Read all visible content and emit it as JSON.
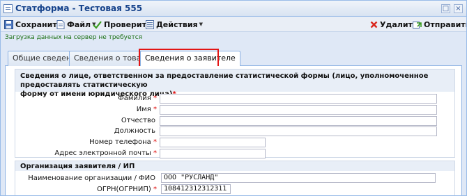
{
  "window": {
    "title": "Статформа - Тестовая 555"
  },
  "toolbar": {
    "save": "Сохранить",
    "file": "Файл",
    "check": "Проверить",
    "actions": "Действия",
    "delete": "Удалить",
    "send": "Отправить"
  },
  "status_text": "Загрузка данных на сервер не требуется",
  "tabs": [
    {
      "label": "Общие сведения"
    },
    {
      "label": "Сведения о товарах"
    },
    {
      "label": "Сведения о заявителе"
    }
  ],
  "section1": {
    "title_line1": "Сведения о лице, ответственном за предоставление статистической формы (лицо, уполномоченное предоставлять статистическую",
    "title_line2": "форму от имени юридического лица)",
    "required_mark": "*",
    "fields": [
      {
        "label": "Фамилия",
        "required": "*",
        "value": ""
      },
      {
        "label": "Имя",
        "required": "*",
        "value": ""
      },
      {
        "label": "Отчество",
        "required": "",
        "value": ""
      },
      {
        "label": "Должность",
        "required": "",
        "value": ""
      },
      {
        "label": "Номер телефона",
        "required": "*",
        "value": ""
      },
      {
        "label": "Адрес электронной почты",
        "required": "*",
        "value": ""
      }
    ]
  },
  "section2": {
    "title": "Организация заявителя / ИП",
    "fields": [
      {
        "label": "Наименование организации / ФИО",
        "required": "",
        "value": "ООО \"РУСЛАНД\""
      },
      {
        "label": "ОГРН(ОГРНИП)",
        "required": "*",
        "value": "108412312312311"
      }
    ]
  }
}
